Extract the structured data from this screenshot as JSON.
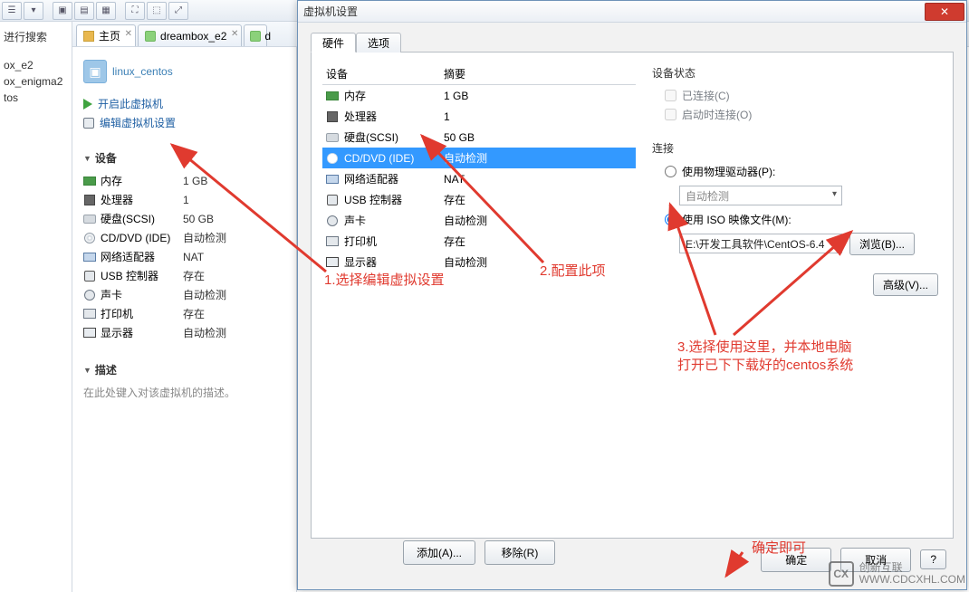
{
  "toolbar": {
    "items": [
      "⟵",
      "⟶",
      "│",
      "▣",
      "▤",
      "▦",
      "│",
      "⛶",
      "⬚",
      "⤢"
    ]
  },
  "lefttree": {
    "search_label": "进行搜索",
    "items": [
      "ox_e2",
      "ox_enigma2",
      "tos"
    ]
  },
  "tabs": [
    {
      "icon": "home",
      "label": "主页"
    },
    {
      "icon": "dbox",
      "label": "dreambox_e2"
    },
    {
      "icon": "dbox",
      "label": "d"
    }
  ],
  "vm": {
    "title": "linux_centos",
    "actions": {
      "power_on": "开启此虚拟机",
      "edit": "编辑虚拟机设置"
    },
    "device_header": "设备",
    "devices": [
      {
        "t": "mem",
        "name": "内存",
        "val": "1 GB"
      },
      {
        "t": "cpu",
        "name": "处理器",
        "val": "1"
      },
      {
        "t": "disk",
        "name": "硬盘(SCSI)",
        "val": "50 GB"
      },
      {
        "t": "cd",
        "name": "CD/DVD (IDE)",
        "val": "自动检测"
      },
      {
        "t": "net",
        "name": "网络适配器",
        "val": "NAT"
      },
      {
        "t": "usb",
        "name": "USB 控制器",
        "val": "存在"
      },
      {
        "t": "snd",
        "name": "声卡",
        "val": "自动检测"
      },
      {
        "t": "prn",
        "name": "打印机",
        "val": "存在"
      },
      {
        "t": "disp",
        "name": "显示器",
        "val": "自动检测"
      }
    ],
    "desc_header": "描述",
    "desc_placeholder": "在此处键入对该虚拟机的描述。"
  },
  "dialog": {
    "title": "虚拟机设置",
    "tabs": {
      "hw": "硬件",
      "opt": "选项"
    },
    "col_device": "设备",
    "col_summary": "摘要",
    "rows": [
      {
        "t": "mem",
        "name": "内存",
        "val": "1 GB"
      },
      {
        "t": "cpu",
        "name": "处理器",
        "val": "1"
      },
      {
        "t": "disk",
        "name": "硬盘(SCSI)",
        "val": "50 GB"
      },
      {
        "t": "cd",
        "name": "CD/DVD (IDE)",
        "val": "自动检测",
        "sel": true
      },
      {
        "t": "net",
        "name": "网络适配器",
        "val": "NAT"
      },
      {
        "t": "usb",
        "name": "USB 控制器",
        "val": "存在"
      },
      {
        "t": "snd",
        "name": "声卡",
        "val": "自动检测"
      },
      {
        "t": "prn",
        "name": "打印机",
        "val": "存在"
      },
      {
        "t": "disp",
        "name": "显示器",
        "val": "自动检测"
      }
    ],
    "add": "添加(A)...",
    "remove": "移除(R)",
    "status": {
      "header": "设备状态",
      "connected": "已连接(C)",
      "on_power": "启动时连接(O)"
    },
    "conn": {
      "header": "连接",
      "phys": "使用物理驱动器(P):",
      "phys_val": "自动检测",
      "iso": "使用 ISO 映像文件(M):",
      "iso_val": "E:\\开发工具软件\\CentOS-6.4"
    },
    "browse": "浏览(B)...",
    "advanced": "高级(V)...",
    "ok": "确定",
    "cancel": "取消",
    "help": "?"
  },
  "anno": {
    "a1": "1.选择编辑虚拟设置",
    "a2": "2.配置此项",
    "a3a": "3.选择使用这里，并本地电脑",
    "a3b": "打开已下下载好的centos系统",
    "a4": "确定即可"
  },
  "watermark": {
    "logo": "CX",
    "line1": "创新互联",
    "line2": "WWW.CDCXHL.COM"
  }
}
